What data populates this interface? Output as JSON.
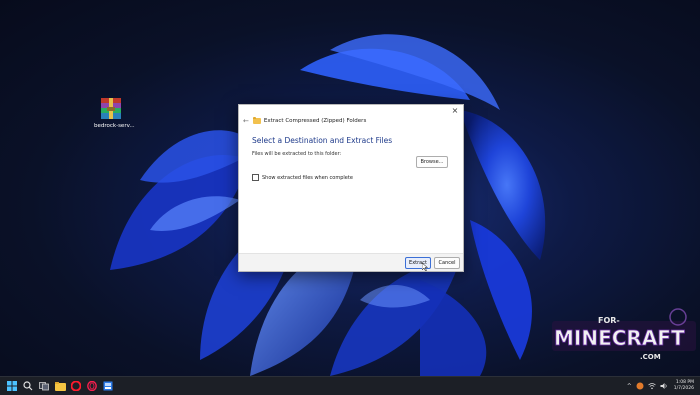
{
  "desktop": {
    "icons": [
      {
        "label": "bedrock-serv...",
        "icon": "winrar-archive-icon"
      }
    ]
  },
  "dialog": {
    "title": "Extract Compressed (Zipped) Folders",
    "heading": "Select a Destination and Extract Files",
    "description": "Files will be extracted to this folder:",
    "browse_label": "Browse...",
    "show_files_label": "Show extracted files when complete",
    "show_files_checked": false,
    "extract_label": "Extract",
    "cancel_label": "Cancel",
    "close_glyph": "×",
    "back_glyph": "←"
  },
  "watermark": {
    "top_text": "FOR-",
    "main_text": "MINECRAFT",
    "bottom_text": ".COM"
  },
  "taskbar": {
    "icons": [
      "windows-start-icon",
      "search-icon",
      "task-view-icon",
      "file-explorer-icon",
      "opera-icon",
      "opera-gx-icon",
      "app-window-icon"
    ],
    "tray": {
      "chevron": "^",
      "clock_time": "1:08 PM",
      "clock_date": "1/7/2026"
    }
  },
  "colors": {
    "accent": "#1e3a8a",
    "wallpaper_blue": "#1a3fd8",
    "taskbar": "#1c1f26"
  }
}
